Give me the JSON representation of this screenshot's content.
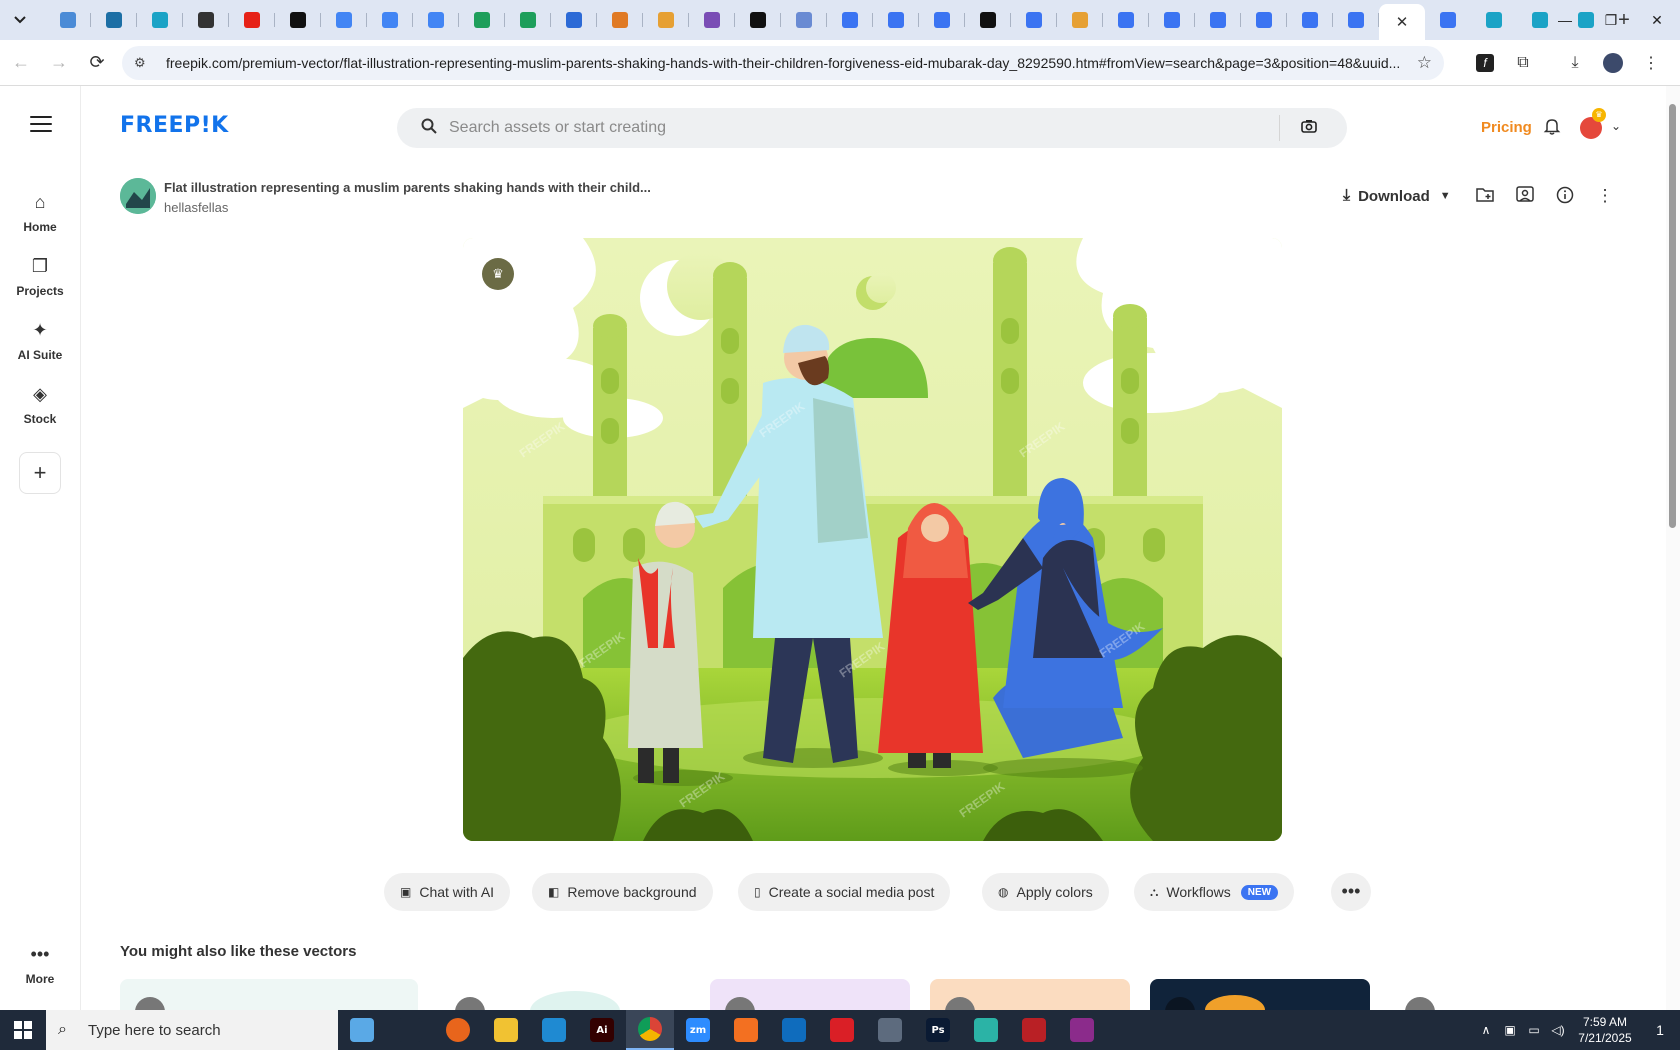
{
  "browser": {
    "tabs": [
      {
        "icon": "google-photos-icon",
        "color": "#4b8bd6"
      },
      {
        "icon": "wordpress-icon",
        "color": "#1d6fa5"
      },
      {
        "icon": "gem-icon",
        "color": "#1ba3c6"
      },
      {
        "icon": "chatgpt-icon",
        "color": "#333333"
      },
      {
        "icon": "youtube-icon",
        "color": "#e62117"
      },
      {
        "icon": "bolt-icon",
        "color": "#111111"
      },
      {
        "icon": "docs-icon",
        "color": "#4285f4"
      },
      {
        "icon": "docs-icon",
        "color": "#4285f4"
      },
      {
        "icon": "docs-icon",
        "color": "#4285f4"
      },
      {
        "icon": "sheets-icon",
        "color": "#1e9e5b"
      },
      {
        "icon": "sheets-icon",
        "color": "#1e9e5b"
      },
      {
        "icon": "word-icon",
        "color": "#2c6ad6"
      },
      {
        "icon": "grid-icon",
        "color": "#e07a24"
      },
      {
        "icon": "bird-icon",
        "color": "#e6a033"
      },
      {
        "icon": "json-icon",
        "color": "#7a4db5"
      },
      {
        "icon": "ai-icon",
        "color": "#111111"
      },
      {
        "icon": "qr-icon",
        "color": "#6a8bd3"
      },
      {
        "icon": "forms-icon",
        "color": "#3b74f2"
      },
      {
        "icon": "forms-icon",
        "color": "#3b74f2"
      },
      {
        "icon": "forms-icon",
        "color": "#3b74f2"
      },
      {
        "icon": "medium-icon",
        "color": "#111111"
      },
      {
        "icon": "forms-icon",
        "color": "#3b74f2"
      },
      {
        "icon": "hand-icon",
        "color": "#e6a033"
      },
      {
        "icon": "forms-icon",
        "color": "#3b74f2"
      },
      {
        "icon": "forms-icon",
        "color": "#3b74f2"
      },
      {
        "icon": "forms-icon",
        "color": "#3b74f2"
      },
      {
        "icon": "forms-icon",
        "color": "#3b74f2"
      },
      {
        "icon": "forms-icon",
        "color": "#3b74f2"
      },
      {
        "icon": "forms-icon",
        "color": "#3b74f2"
      }
    ],
    "tail_tabs": [
      {
        "icon": "forms-icon",
        "color": "#3b74f2"
      },
      {
        "icon": "gem-icon",
        "color": "#1ba3c6"
      },
      {
        "icon": "gem-icon",
        "color": "#1ba3c6"
      },
      {
        "icon": "gem-icon",
        "color": "#1ba3c6"
      }
    ],
    "url": "freepik.com/premium-vector/flat-illustration-representing-muslim-parents-shaking-hands-with-their-children-forgiveness-eid-mubarak-day_8292590.htm#fromView=search&page=3&position=48&uuid..."
  },
  "rail": {
    "items": [
      {
        "label": "Home",
        "icon": "home-icon"
      },
      {
        "label": "Projects",
        "icon": "projects-icon"
      },
      {
        "label": "AI Suite",
        "icon": "sparkle-icon"
      },
      {
        "label": "Stock",
        "icon": "stock-icon"
      }
    ],
    "more_label": "More"
  },
  "header": {
    "logo": "FREEP!K",
    "search_placeholder": "Search assets or start creating",
    "pricing": "Pricing"
  },
  "resource": {
    "title": "Flat illustration representing a muslim parents shaking hands with their child...",
    "author": "hellasfellas",
    "download_label": "Download"
  },
  "actions": [
    {
      "label": "Chat with AI",
      "icon": "chat-icon"
    },
    {
      "label": "Remove background",
      "icon": "remove-bg-icon"
    },
    {
      "label": "Create a social media post",
      "icon": "phone-icon"
    },
    {
      "label": "Apply colors",
      "icon": "palette-icon"
    },
    {
      "label": "Workflows",
      "icon": "workflow-icon",
      "badge": "NEW"
    }
  ],
  "related": {
    "title": "You might also like these vectors"
  },
  "taskbar": {
    "search_placeholder": "Type here to search",
    "apps": [
      {
        "name": "weather-icon",
        "label": "",
        "color": "#5aa9e6"
      },
      {
        "name": "task-view-icon",
        "label": "",
        "color": "#1f2a3a"
      },
      {
        "name": "firefox-icon",
        "label": "",
        "color": "#e8651c"
      },
      {
        "name": "file-explorer-icon",
        "label": "",
        "color": "#f1c232"
      },
      {
        "name": "vscode-icon",
        "label": "",
        "color": "#1f8ad2"
      },
      {
        "name": "illustrator-icon",
        "label": "Ai",
        "color": "#330000"
      },
      {
        "name": "chrome-icon",
        "label": "",
        "color": "#3b8a4e"
      },
      {
        "name": "zoom-icon",
        "label": "zm",
        "color": "#2d8cff"
      },
      {
        "name": "xampp-icon",
        "label": "",
        "color": "#f37021"
      },
      {
        "name": "outlook-icon",
        "label": "",
        "color": "#0f6cbd"
      },
      {
        "name": "creative-cloud-icon",
        "label": "",
        "color": "#da1f26"
      },
      {
        "name": "pen-icon",
        "label": "",
        "color": "#5d6b7e"
      },
      {
        "name": "photoshop-icon",
        "label": "Ps",
        "color": "#0a1a33"
      },
      {
        "name": "gem-app-icon",
        "label": "",
        "color": "#2bb3a6"
      },
      {
        "name": "filezilla-icon",
        "label": "",
        "color": "#b92025"
      },
      {
        "name": "winrar-icon",
        "label": "",
        "color": "#8b2b8b"
      }
    ],
    "time": "7:59 AM",
    "date": "7/21/2025",
    "notification_count": "1"
  }
}
